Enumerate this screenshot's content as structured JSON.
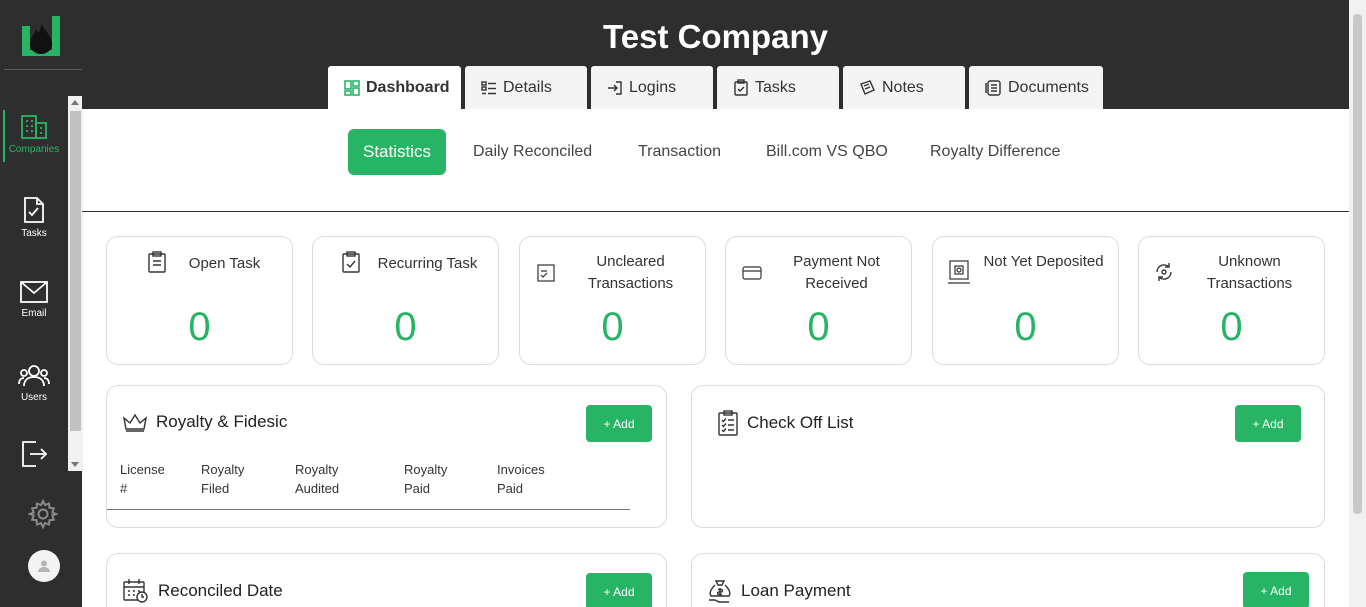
{
  "company_title": "Test Company",
  "sidebar": {
    "items": [
      {
        "label": "Companies"
      },
      {
        "label": "Tasks"
      },
      {
        "label": "Email"
      },
      {
        "label": "Users"
      }
    ]
  },
  "main_tabs": [
    {
      "label": "Dashboard"
    },
    {
      "label": "Details"
    },
    {
      "label": "Logins"
    },
    {
      "label": "Tasks"
    },
    {
      "label": "Notes"
    },
    {
      "label": "Documents"
    }
  ],
  "sub_tabs": [
    {
      "label": "Statistics"
    },
    {
      "label": "Daily Reconciled"
    },
    {
      "label": "Transaction"
    },
    {
      "label": "Bill.com VS QBO"
    },
    {
      "label": "Royalty Difference"
    }
  ],
  "stats": [
    {
      "title": "Open Task",
      "value": "0",
      "icon": "clipboard-icon"
    },
    {
      "title": "Recurring Task",
      "value": "0",
      "icon": "clipboard-check-icon"
    },
    {
      "title": "Uncleared Transactions",
      "value": "0",
      "icon": "checklist-icon"
    },
    {
      "title": "Payment Not Received",
      "value": "0",
      "icon": "card-icon"
    },
    {
      "title": "Not Yet Deposited",
      "value": "0",
      "icon": "deposit-icon"
    },
    {
      "title": "Unknown Transactions",
      "value": "0",
      "icon": "refresh-icon"
    }
  ],
  "panels": {
    "royalty": {
      "title": "Royalty & Fidesic",
      "add_label": "+ Add",
      "columns": [
        [
          "License",
          "#"
        ],
        [
          "Royalty",
          "Filed"
        ],
        [
          "Royalty",
          "Audited"
        ],
        [
          "Royalty",
          "Paid"
        ],
        [
          "Invoices",
          "Paid"
        ]
      ]
    },
    "checkoff": {
      "title": "Check Off List",
      "add_label": "+ Add"
    },
    "reconciled": {
      "title": "Reconciled Date",
      "add_label": "+ Add"
    },
    "loan": {
      "title": "Loan Payment",
      "add_label": "+ Add"
    }
  },
  "colors": {
    "accent": "#27b565",
    "dark": "#2e2e2e"
  }
}
